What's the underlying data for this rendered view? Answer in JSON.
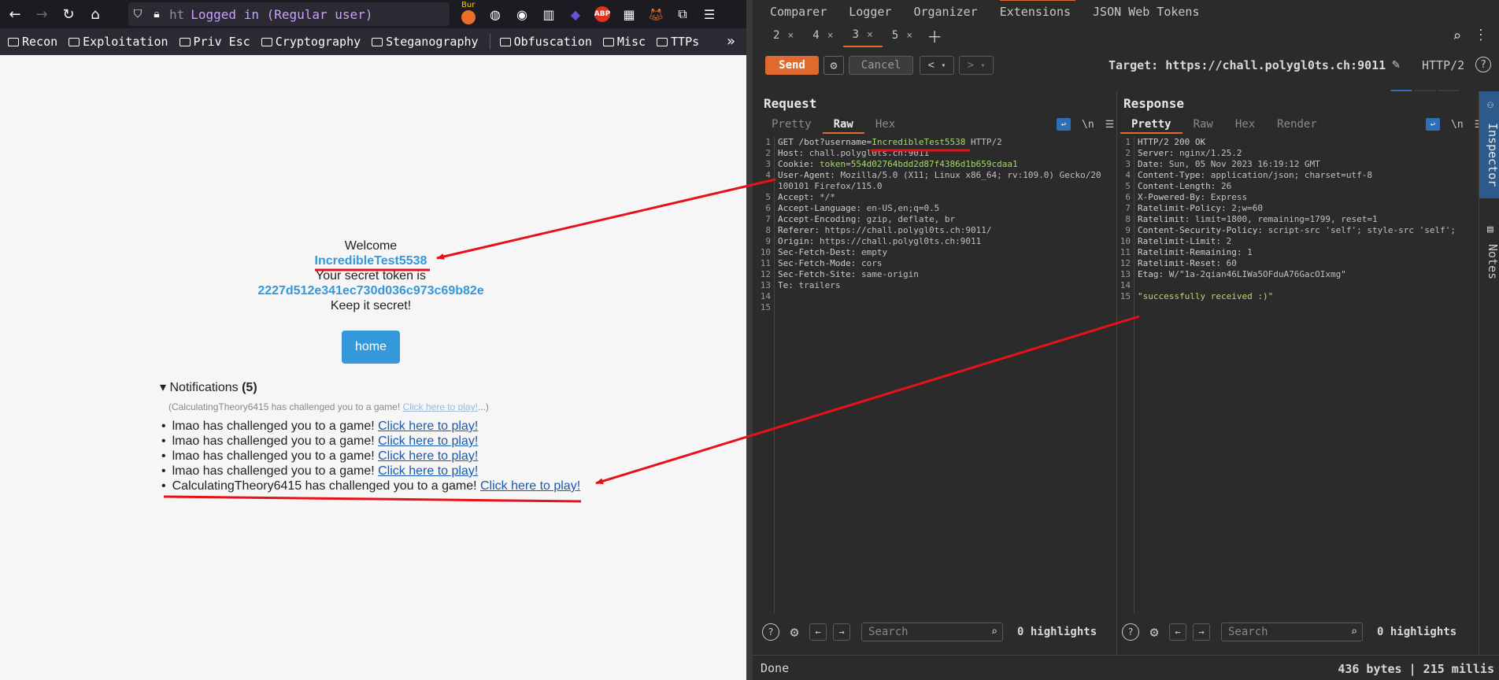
{
  "firefox": {
    "url_faded": "ht",
    "page_title": "Logged in (Regular user)",
    "burp_ext_label": "Bur",
    "abp_label": "ABP",
    "bookmarks": [
      "Recon",
      "Exploitation",
      "Priv Esc",
      "Cryptography",
      "Steganography",
      "Obfuscation",
      "Misc",
      "TTPs"
    ],
    "page": {
      "welcome": "Welcome",
      "username": "IncredibleTest5538",
      "token_label": "Your secret token is",
      "token": "2227d512e341ec730d036c973c69b82e",
      "keep_secret": "Keep it secret!",
      "home_button": "home",
      "notifications_label": "Notifications",
      "notifications_count": "(5)",
      "faded_text": "(CalculatingTheory6415 has challenged you to a game! ",
      "faded_link": "Click here to play!",
      "faded_tail": "...)",
      "notifications": [
        {
          "text": "lmao has challenged you to a game! ",
          "link": "Click here to play!"
        },
        {
          "text": "lmao has challenged you to a game! ",
          "link": "Click here to play!"
        },
        {
          "text": "lmao has challenged you to a game! ",
          "link": "Click here to play!"
        },
        {
          "text": "lmao has challenged you to a game! ",
          "link": "Click here to play!"
        },
        {
          "text": "CalculatingTheory6415 has challenged you to a game! ",
          "link": "Click here to play!"
        }
      ]
    }
  },
  "burp": {
    "top_tabs": [
      "Comparer",
      "Logger",
      "Organizer",
      "Extensions",
      "JSON Web Tokens"
    ],
    "repeater_tabs": [
      "2",
      "4",
      "3",
      "5"
    ],
    "close_glyph": "×",
    "send_label": "Send",
    "cancel_label": "Cancel",
    "target": "Target: https://chall.polygl0ts.ch:9011",
    "protocol": "HTTP/2",
    "request_title": "Request",
    "response_title": "Response",
    "request_tabs": [
      "Pretty",
      "Raw",
      "Hex"
    ],
    "response_tabs": [
      "Pretty",
      "Raw",
      "Hex",
      "Render"
    ],
    "newline_label": "\\n",
    "request_lines": [
      {
        "n": "1",
        "k": "GET /bot?username=",
        "h": "IncredibleTest5538",
        "v": " HTTP/2"
      },
      {
        "n": "2",
        "k": "Host: ",
        "h": "",
        "v": "chall.polygl0ts.ch:9011"
      },
      {
        "n": "3",
        "k": "Cookie: ",
        "h": "token=554d02764bdd2d87f4386d1b659cdaa1",
        "v": ""
      },
      {
        "n": "4",
        "k": "User-Agent: ",
        "h": "",
        "v": "Mozilla/5.0 (X11; Linux x86_64; rv:109.0) Gecko/20100101 Firefox/115.0"
      },
      {
        "n": "5",
        "k": "Accept: ",
        "h": "",
        "v": "*/*"
      },
      {
        "n": "6",
        "k": "Accept-Language: ",
        "h": "",
        "v": "en-US,en;q=0.5"
      },
      {
        "n": "7",
        "k": "Accept-Encoding: ",
        "h": "",
        "v": "gzip, deflate, br"
      },
      {
        "n": "8",
        "k": "Referer: ",
        "h": "",
        "v": "https://chall.polygl0ts.ch:9011/"
      },
      {
        "n": "9",
        "k": "Origin: ",
        "h": "",
        "v": "https://chall.polygl0ts.ch:9011"
      },
      {
        "n": "10",
        "k": "Sec-Fetch-Dest: ",
        "h": "",
        "v": "empty"
      },
      {
        "n": "11",
        "k": "Sec-Fetch-Mode: ",
        "h": "",
        "v": "cors"
      },
      {
        "n": "12",
        "k": "Sec-Fetch-Site: ",
        "h": "",
        "v": "same-origin"
      },
      {
        "n": "13",
        "k": "Te: ",
        "h": "",
        "v": "trailers"
      },
      {
        "n": "14",
        "k": "",
        "h": "",
        "v": ""
      },
      {
        "n": "15",
        "k": "",
        "h": "",
        "v": ""
      }
    ],
    "response_lines": [
      {
        "n": "1",
        "k": "HTTP/2 200 OK",
        "h": "",
        "v": ""
      },
      {
        "n": "2",
        "k": "Server: ",
        "h": "",
        "v": "nginx/1.25.2"
      },
      {
        "n": "3",
        "k": "Date: ",
        "h": "",
        "v": "Sun, 05 Nov 2023 16:19:12 GMT"
      },
      {
        "n": "4",
        "k": "Content-Type: ",
        "h": "",
        "v": "application/json; charset=utf-8"
      },
      {
        "n": "5",
        "k": "Content-Length: ",
        "h": "",
        "v": "26"
      },
      {
        "n": "6",
        "k": "X-Powered-By: ",
        "h": "",
        "v": "Express"
      },
      {
        "n": "7",
        "k": "Ratelimit-Policy: ",
        "h": "",
        "v": "2;w=60"
      },
      {
        "n": "8",
        "k": "Ratelimit: ",
        "h": "",
        "v": "limit=1800, remaining=1799, reset=1"
      },
      {
        "n": "9",
        "k": "Content-Security-Policy: ",
        "h": "",
        "v": "script-src 'self'; style-src 'self';"
      },
      {
        "n": "10",
        "k": "Ratelimit-Limit: ",
        "h": "",
        "v": "2"
      },
      {
        "n": "11",
        "k": "Ratelimit-Remaining: ",
        "h": "",
        "v": "1"
      },
      {
        "n": "12",
        "k": "Ratelimit-Reset: ",
        "h": "",
        "v": "60"
      },
      {
        "n": "13",
        "k": "Etag: ",
        "h": "",
        "v": "W/\"1a-2qian46LIWa5OFduA76GacOIxmg\""
      },
      {
        "n": "14",
        "k": "",
        "h": "",
        "v": ""
      },
      {
        "n": "15",
        "k": "",
        "h": "\"successfully received :)\"",
        "v": ""
      }
    ],
    "search_placeholder": "Search",
    "highlights": "0 highlights",
    "side_inspector": "Inspector",
    "side_notes": "Notes",
    "status_left": "Done",
    "status_right": "436 bytes | 215 millis"
  },
  "colors": {
    "burp_accent": "#e06a2e",
    "link_blue": "#3498db",
    "annotation_red": "#e8111a"
  }
}
